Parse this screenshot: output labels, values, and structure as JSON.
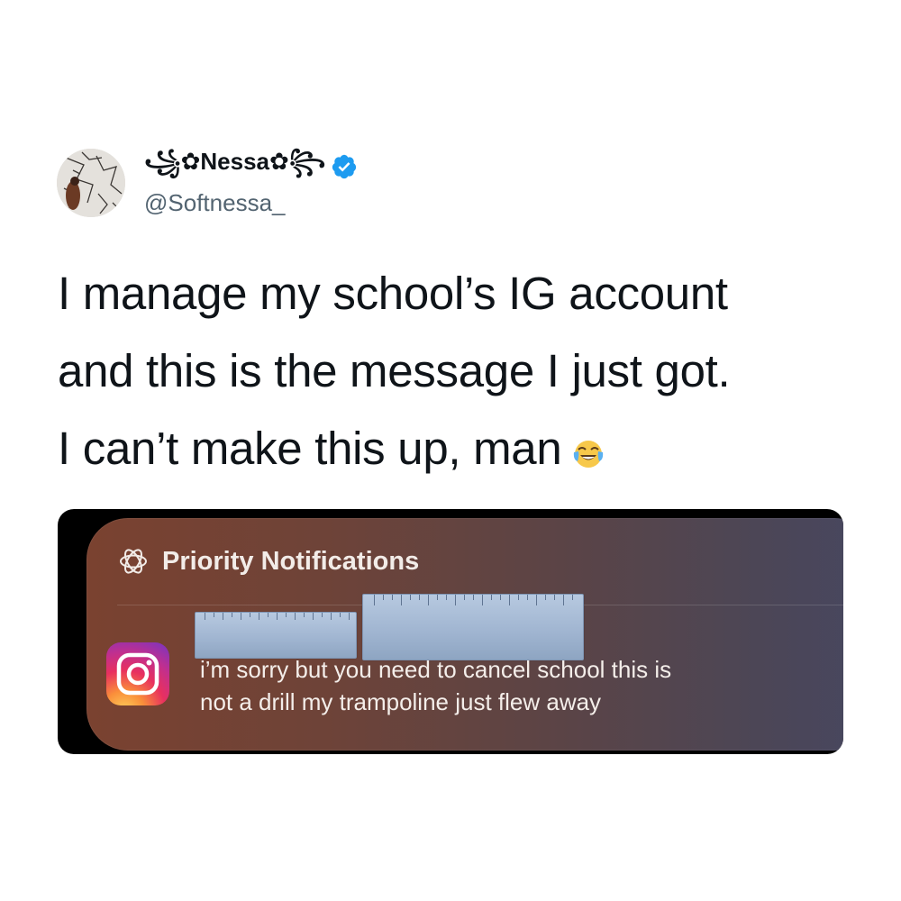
{
  "tweet": {
    "display_name": "꧁✿Nessa✿꧂",
    "handle": "@Softnessa_",
    "verified_icon": "verified-badge-icon",
    "text_lines": [
      "I manage my school’s IG account",
      "and this is the message I just got.",
      "I can’t make this up, man"
    ],
    "emoji": "face-with-tears-of-joy-icon"
  },
  "notification": {
    "header_icon": "apple-intelligence-icon",
    "header_title": "Priority Notifications",
    "app_icon": "instagram-icon",
    "redaction": "ruler-redaction-overlay",
    "message_lines": [
      "i’m sorry but you need to cancel school this is",
      "not a drill my trampoline just flew away"
    ]
  },
  "colors": {
    "text_primary": "#0f1419",
    "text_secondary": "#536471",
    "verified_blue": "#1d9bf0",
    "notification_bg_left": "#7a4230",
    "notification_bg_right": "#474760"
  }
}
